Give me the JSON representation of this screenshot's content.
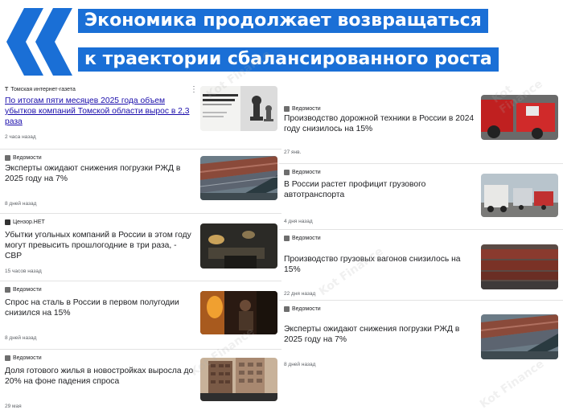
{
  "header": {
    "title_line1": "Экономика продолжает возвращаться",
    "title_line2": "к траектории сбалансированного роста",
    "colors": {
      "accent": "#1a6fd6"
    }
  },
  "watermark": "Kot Finance",
  "left_feed": [
    {
      "source": "Томская интернет-газета",
      "headline": "По итогам пяти месяцев 2025 года объем убытков компаний Томской области вырос в 2,3 раза",
      "time": "2 часа назад",
      "thumb_icon": "document-chess-icon",
      "thumb_text": "Стратегический учет для вашего бизнеса"
    },
    {
      "source": "Ведомости",
      "headline": "Эксперты ожидают снижения погрузки РЖД в 2025 году на 7%",
      "time": "8 дней назад",
      "thumb_icon": "rail-wagons-icon"
    },
    {
      "source": "Цензор.НЕТ",
      "headline": "Убытки угольных компаний в России в этом году могут превысить прошлогодние в три раза, - CBP",
      "time": "15 часов назад",
      "thumb_icon": "coal-mine-icon"
    },
    {
      "source": "Ведомости",
      "headline": "Спрос на сталь в России в первом полугодии снизился на 15%",
      "time": "8 дней назад",
      "thumb_icon": "steelworker-icon"
    },
    {
      "source": "Ведомости",
      "headline": "Доля готового жилья в новостройках выросла до 20% на фоне падения спроса",
      "time": "29 мая",
      "thumb_icon": "building-icon"
    }
  ],
  "right_feed": [
    {
      "source": "Ведомости",
      "headline": "Производство дорожной техники в России в 2024 году снизилось на 15%",
      "time": "27 янв.",
      "thumb_icon": "road-machinery-icon"
    },
    {
      "source": "Ведомости",
      "headline": "В России растет профицит грузового автотранспорта",
      "time": "4 дня назад",
      "thumb_icon": "trucks-icon"
    },
    {
      "source": "Ведомости",
      "headline": "Производство грузовых вагонов снизилось на 15%",
      "time": "22 дня назад",
      "thumb_icon": "freight-wagons-icon"
    },
    {
      "source": "Ведомости",
      "headline": "Эксперты ожидают снижения погрузки РЖД в 2025 году на 7%",
      "time": "8 дней назад",
      "thumb_icon": "rail-wagons-icon"
    }
  ]
}
